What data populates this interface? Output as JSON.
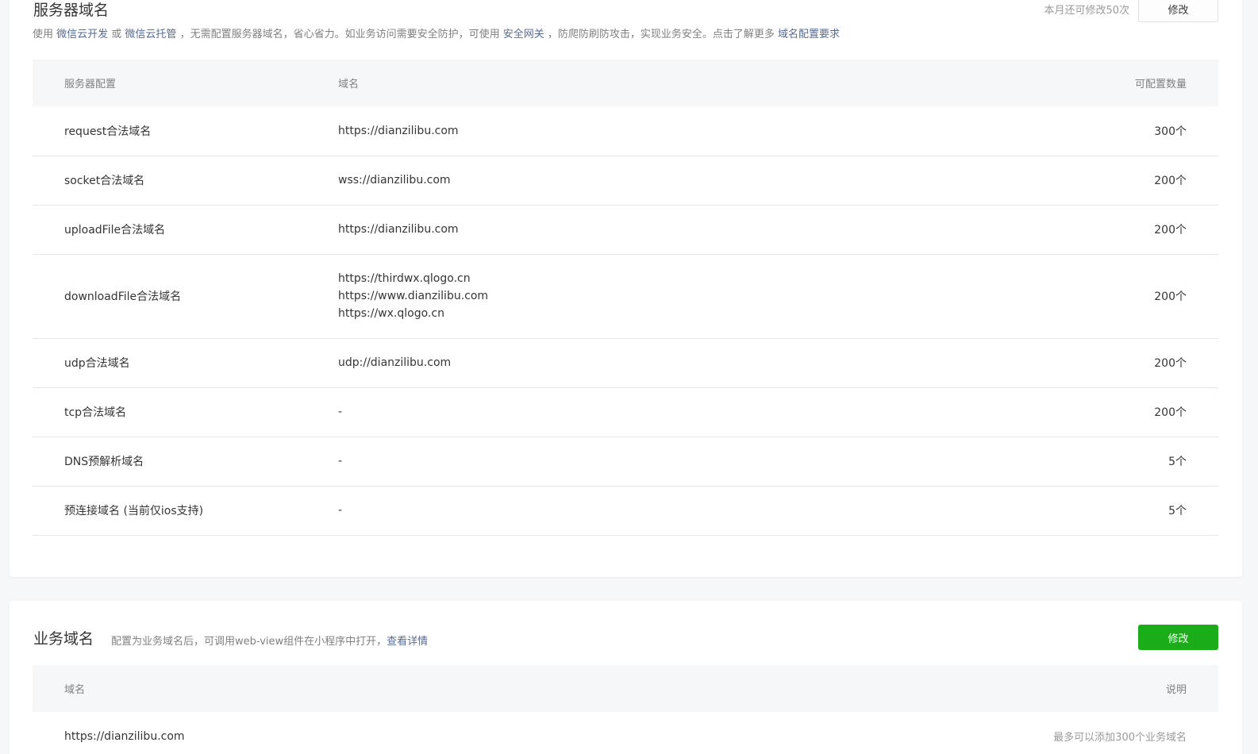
{
  "server": {
    "title": "服务器域名",
    "desc": {
      "part1": "使用 ",
      "link1": "微信云开发",
      "part2": " 或 ",
      "link2": "微信云托管",
      "part3": " ，无需配置服务器域名，省心省力。如业务访问需要安全防护，可使用 ",
      "link3": "安全网关",
      "part4": " ，防爬防刷防攻击，实现业务安全。点击了解更多 ",
      "link4": "域名配置要求"
    },
    "quota_text": "本月还可修改50次",
    "edit_label": "修改",
    "headers": [
      "服务器配置",
      "域名",
      "可配置数量"
    ],
    "rows": [
      {
        "config": "request合法域名",
        "domains": [
          "https://dianzilibu.com"
        ],
        "count": "300个"
      },
      {
        "config": "socket合法域名",
        "domains": [
          "wss://dianzilibu.com"
        ],
        "count": "200个"
      },
      {
        "config": "uploadFile合法域名",
        "domains": [
          "https://dianzilibu.com"
        ],
        "count": "200个"
      },
      {
        "config": "downloadFile合法域名",
        "domains": [
          "https://thirdwx.qlogo.cn",
          "https://www.dianzilibu.com",
          "https://wx.qlogo.cn"
        ],
        "count": "200个"
      },
      {
        "config": "udp合法域名",
        "domains": [
          "udp://dianzilibu.com"
        ],
        "count": "200个"
      },
      {
        "config": "tcp合法域名",
        "domains": [
          "-"
        ],
        "count": "200个"
      },
      {
        "config": "DNS预解析域名",
        "domains": [
          "-"
        ],
        "count": "5个"
      },
      {
        "config": "预连接域名 (当前仅ios支持)",
        "domains": [
          "-"
        ],
        "count": "5个"
      }
    ]
  },
  "business": {
    "title": "业务域名",
    "desc": "配置为业务域名后，可调用web-view组件在小程序中打开，",
    "desc_link": "查看详情",
    "edit_label": "修改",
    "headers": [
      "域名",
      "说明"
    ],
    "rows": [
      {
        "domain": "https://dianzilibu.com",
        "note": "最多可以添加300个业务域名"
      }
    ]
  },
  "colors": {
    "primary_green": "#1aad19",
    "link_blue": "#576b95",
    "page_bg": "#f6f7f9"
  }
}
